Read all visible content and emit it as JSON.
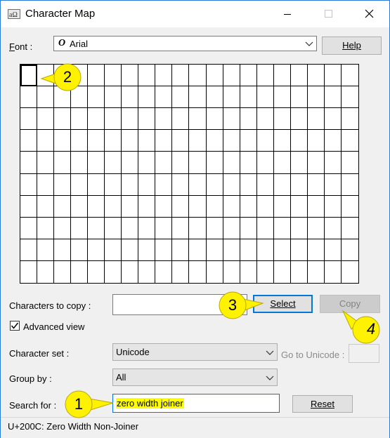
{
  "window": {
    "title": "Character Map",
    "icon": "character-map-app-icon"
  },
  "font": {
    "label_prefix": "",
    "label_underline": "F",
    "label_rest": "ont :",
    "selected": "Arial",
    "font_type_glyph": "O"
  },
  "buttons": {
    "help": "Help",
    "select": "Select",
    "copy": "Copy",
    "reset": "Reset"
  },
  "characters_to_copy": {
    "label": "Characters to copy :",
    "value": ""
  },
  "advanced_view": {
    "label": "Advanced view",
    "checked": true
  },
  "character_set": {
    "label": "Character set :",
    "value": "Unicode"
  },
  "go_to_unicode": {
    "label": "Go to Unicode :",
    "value": ""
  },
  "group_by": {
    "label": "Group by :",
    "value": "All"
  },
  "search": {
    "label": "Search for :",
    "value": "zero width joiner"
  },
  "status": {
    "text": "U+200C: Zero Width Non-Joiner"
  },
  "callouts": [
    "1",
    "2",
    "3",
    "4"
  ],
  "colors": {
    "callout_fill": "#fff200",
    "highlight": "#ffff00",
    "accent": "#0078d7"
  }
}
